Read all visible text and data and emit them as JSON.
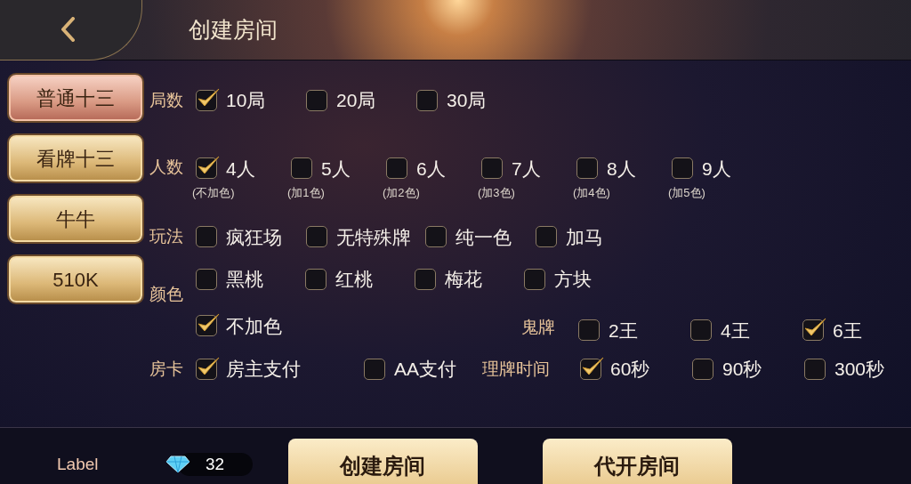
{
  "header": {
    "title": "创建房间"
  },
  "sidebar": {
    "items": [
      {
        "label": "普通十三",
        "selected": true
      },
      {
        "label": "看牌十三",
        "selected": false
      },
      {
        "label": "牛牛",
        "selected": false
      },
      {
        "label": "510K",
        "selected": false
      }
    ]
  },
  "rounds": {
    "label": "局数",
    "options": [
      {
        "label": "10局",
        "checked": true
      },
      {
        "label": "20局",
        "checked": false
      },
      {
        "label": "30局",
        "checked": false
      }
    ]
  },
  "players": {
    "label": "人数",
    "options": [
      {
        "label": "4人",
        "sub": "(不加色)",
        "checked": true
      },
      {
        "label": "5人",
        "sub": "(加1色)",
        "checked": false
      },
      {
        "label": "6人",
        "sub": "(加2色)",
        "checked": false
      },
      {
        "label": "7人",
        "sub": "(加3色)",
        "checked": false
      },
      {
        "label": "8人",
        "sub": "(加4色)",
        "checked": false
      },
      {
        "label": "9人",
        "sub": "(加5色)",
        "checked": false
      }
    ]
  },
  "play_modes": {
    "label": "玩法",
    "options": [
      {
        "label": "疯狂场",
        "checked": false
      },
      {
        "label": "无特殊牌",
        "checked": false
      },
      {
        "label": "纯一色",
        "checked": false
      },
      {
        "label": "加马",
        "checked": false
      }
    ]
  },
  "colors": {
    "label": "颜色",
    "options": [
      {
        "label": "黑桃",
        "checked": false
      },
      {
        "label": "红桃",
        "checked": false
      },
      {
        "label": "梅花",
        "checked": false
      },
      {
        "label": "方块",
        "checked": false
      }
    ],
    "no_color": {
      "label": "不加色",
      "checked": true
    }
  },
  "ghost_cards": {
    "label": "鬼牌",
    "options": [
      {
        "label": "2王",
        "checked": false
      },
      {
        "label": "4王",
        "checked": false
      },
      {
        "label": "6王",
        "checked": true
      }
    ]
  },
  "room_card": {
    "label": "房卡",
    "options": [
      {
        "label": "房主支付",
        "checked": true
      },
      {
        "label": "AA支付",
        "checked": false
      }
    ]
  },
  "sort_time": {
    "label": "理牌时间",
    "options": [
      {
        "label": "60秒",
        "checked": true
      },
      {
        "label": "90秒",
        "checked": false
      },
      {
        "label": "300秒",
        "checked": false
      }
    ]
  },
  "footer": {
    "label": "Label",
    "diamonds": "32",
    "buttons": [
      "创建房间",
      "代开房间"
    ]
  }
}
